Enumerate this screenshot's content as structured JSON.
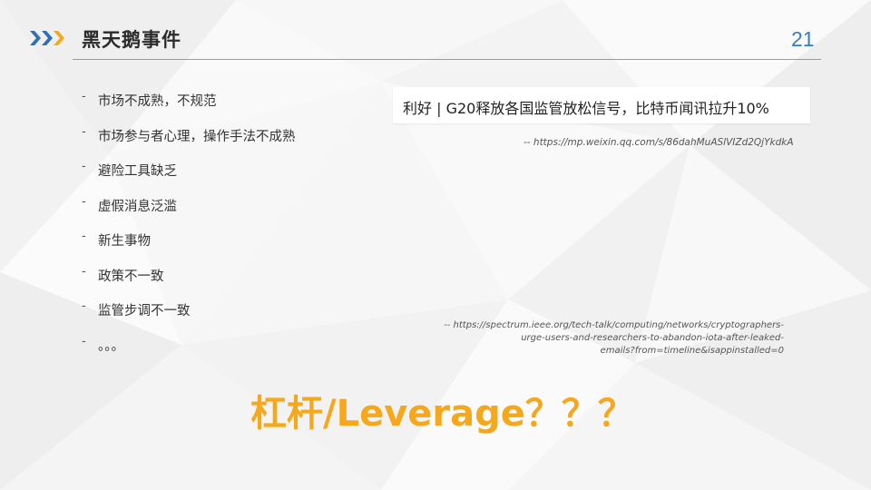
{
  "slide": {
    "title": "黑天鹅事件",
    "page_number": "21"
  },
  "bullets": [
    "市场不成熟，不规范",
    "市场参与者心理，操作手法不成熟",
    "避险工具缺乏",
    "虚假消息泛滥",
    "新生事物",
    "政策不一致",
    "监管步调不一致",
    "。。。"
  ],
  "bullet_marker": "-",
  "headline": "利好 | G20释放各国监管放松信号，比特币闻讯拉升10%",
  "source_1": "-- https://mp.weixin.qq.com/s/86dahMuASlVIZd2QjYkdkA",
  "source_2": {
    "line1": "-- https://spectrum.ieee.org/tech-talk/computing/networks/cryptographers-",
    "line2": "urge-users-and-researchers-to-abandon-iota-after-leaked-",
    "line3": "emails?from=timeline&isappinstalled=0"
  },
  "big_question": "杠杆/Leverage？？？",
  "colors": {
    "accent_orange": "#f5a81c",
    "logo_blue": "#2f6fb3",
    "page_number_blue": "#2f7fc1"
  }
}
